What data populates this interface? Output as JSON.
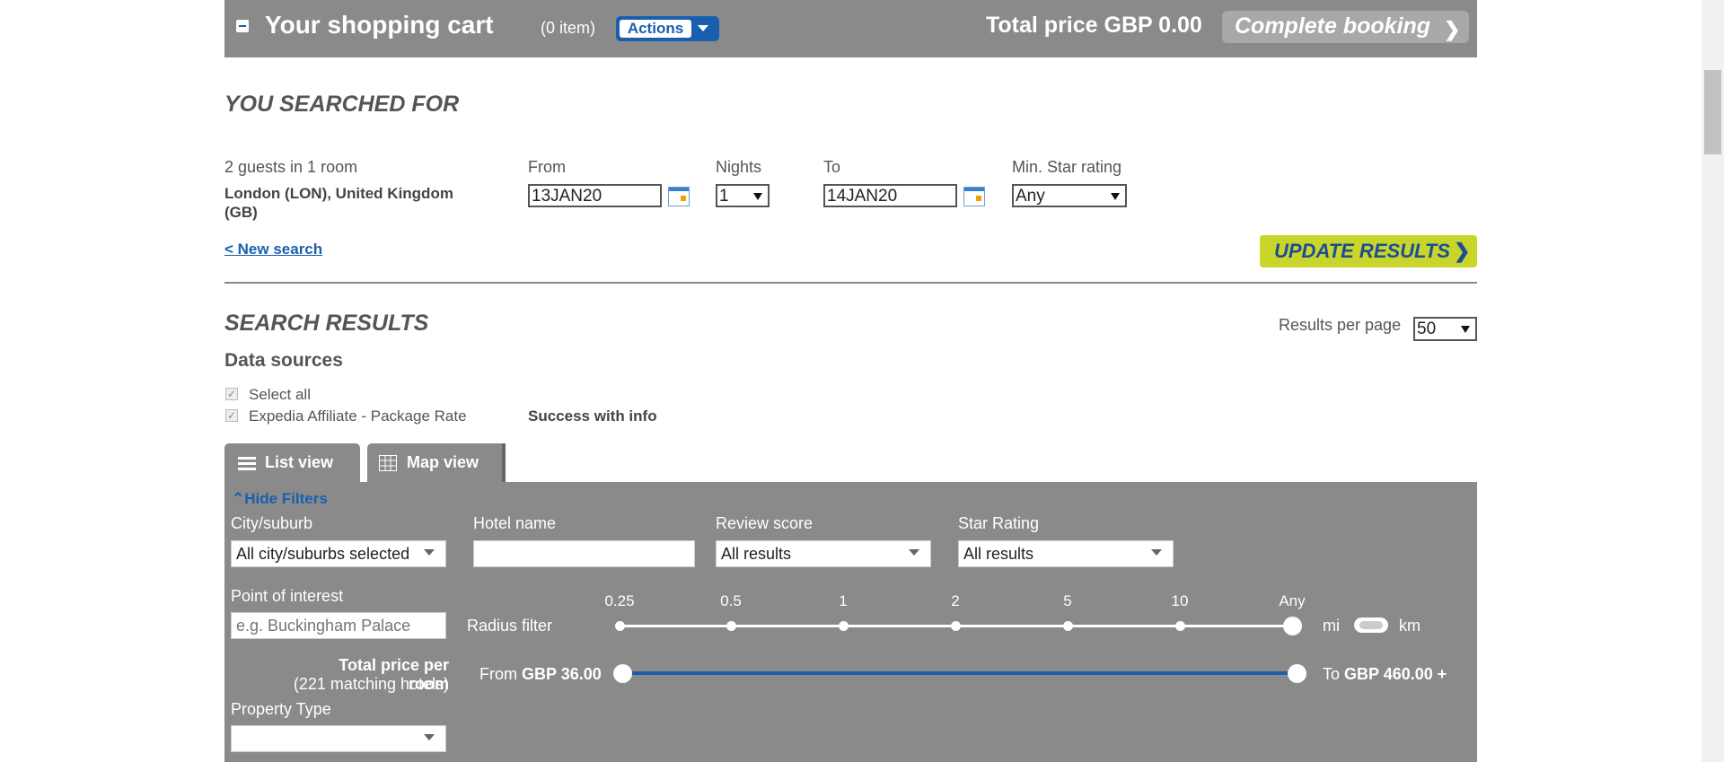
{
  "cart": {
    "title": "Your shopping cart",
    "count": "(0 item)",
    "actions_label": "Actions",
    "total_label": "Total price GBP 0.00",
    "complete_label": "Complete booking"
  },
  "search": {
    "section_title": "YOU SEARCHED FOR",
    "guests": "2 guests in 1 room",
    "destination": "London (LON), United Kingdom (GB)",
    "from_label": "From",
    "from_value": "13JAN20",
    "nights_label": "Nights",
    "nights_value": "1",
    "to_label": "To",
    "to_value": "14JAN20",
    "star_label": "Min. Star rating",
    "star_value": "Any",
    "new_search": "< New search",
    "update_label": "UPDATE RESULTS"
  },
  "results": {
    "section_title": "SEARCH RESULTS",
    "rpp_label": "Results per page",
    "rpp_value": "50",
    "data_sources_title": "Data sources",
    "select_all": "Select all",
    "source_name": "Expedia Affiliate - Package Rate",
    "source_status": "Success with info",
    "tabs": {
      "list": "List view",
      "map": "Map view"
    }
  },
  "filters": {
    "hide_label": "Hide Filters",
    "city_label": "City/suburb",
    "city_value": "All city/suburbs selected",
    "hotel_label": "Hotel name",
    "hotel_value": "",
    "review_label": "Review score",
    "review_value": "All results",
    "star_label": "Star Rating",
    "star_value": "All results",
    "poi_label": "Point of interest",
    "poi_placeholder": "e.g. Buckingham Palace",
    "radius_label": "Radius filter",
    "radius_ticks": [
      "0.25",
      "0.5",
      "1",
      "2",
      "5",
      "10",
      "Any"
    ],
    "radius_selected": "Any",
    "unit_mi": "mi",
    "unit_km": "km",
    "price_label": "Total price per room",
    "price_matches": "(221 matching hotels)",
    "price_from_prefix": "From",
    "price_from_value": "GBP 36.00",
    "price_to_prefix": "To",
    "price_to_value": "GBP 460.00 +",
    "property_label": "Property Type",
    "property_value": ""
  },
  "colors": {
    "accent_blue": "#1a5fae",
    "bar_grey": "#8a8a8a",
    "update_yellow": "#c9d52b"
  },
  "icons": [
    "minus-icon",
    "caret-down-icon",
    "chevron-right-icon",
    "calendar-icon",
    "list-icon",
    "grid-icon",
    "chevron-up-icon"
  ]
}
